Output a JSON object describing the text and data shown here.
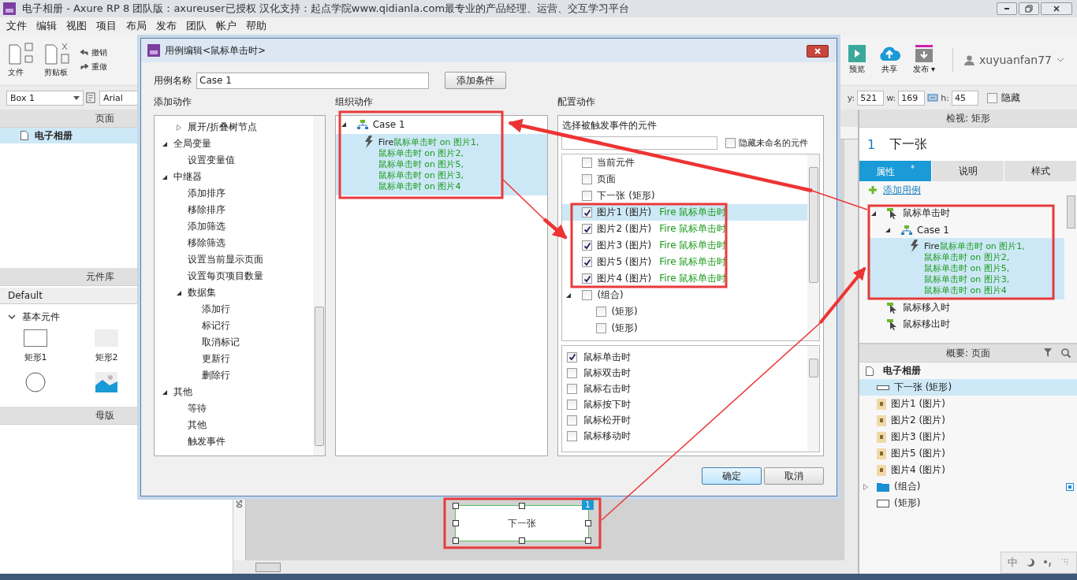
{
  "window": {
    "title": "电子相册 - Axure RP 8 团队版：axureuser已授权 汉化支持：起点学院www.qidianla.com最专业的产品经理、运营、交互学习平台"
  },
  "menu": [
    "文件",
    "编辑",
    "视图",
    "项目",
    "布局",
    "发布",
    "团队",
    "帐户",
    "帮助"
  ],
  "toolbar": {
    "left": [
      {
        "label": "文件",
        "kind": "file"
      },
      {
        "label": "剪贴板",
        "kind": "clipboard"
      }
    ],
    "undo": "撤销",
    "redo": "重做",
    "right": [
      {
        "label": "预览",
        "kind": "preview"
      },
      {
        "label": "共享",
        "kind": "share"
      },
      {
        "label": "发布 ▾",
        "kind": "publish"
      }
    ],
    "user": "xuyuanfan77"
  },
  "format_bar": {
    "widget_name": "Box 1",
    "font": "Arial",
    "fields": [
      {
        "label": "y:",
        "value": "521"
      },
      {
        "label": "w:",
        "value": "169"
      },
      {
        "label": "h:",
        "value": "45"
      }
    ],
    "hidden_label": "隐藏",
    "hidden": false
  },
  "pages_panel": {
    "title": "页面",
    "items": [
      {
        "label": "电子相册",
        "selected": true
      }
    ]
  },
  "library_panel": {
    "title": "元件库",
    "library": "Default",
    "group": "基本元件",
    "expanded": true,
    "widgets": [
      {
        "label": "矩形1",
        "kind": "rect"
      },
      {
        "label": "矩形2",
        "kind": "shaded"
      },
      {
        "kind": "circle"
      },
      {
        "kind": "image"
      }
    ]
  },
  "masters_panel": {
    "title": "母版"
  },
  "canvas": {
    "ruler_mark": "50",
    "widget": {
      "label": "下一张",
      "badge": "1",
      "selected": true
    }
  },
  "inspector": {
    "title": "检视: 矩形",
    "number": "1",
    "name": "下一张",
    "tabs": [
      {
        "label": "属性",
        "badge": "*",
        "selected": true
      },
      {
        "label": "说明",
        "selected": false
      },
      {
        "label": "样式",
        "selected": false
      }
    ],
    "add_case": "添加用例",
    "events": [
      {
        "label": "鼠标单击时",
        "expanded": true,
        "cases": [
          {
            "label": "Case 1",
            "expanded": true,
            "action": {
              "verb": "Fire",
              "lines": [
                "鼠标单击时 on 图片1,",
                "鼠标单击时 on 图片2,",
                "鼠标单击时 on 图片5,",
                "鼠标单击时 on 图片3,",
                "鼠标单击时 on 图片4"
              ],
              "selected": true
            }
          }
        ]
      },
      {
        "label": "鼠标移入时"
      },
      {
        "label": "鼠标移出时"
      }
    ]
  },
  "outline": {
    "title": "概要: 页面",
    "page": "电子相册",
    "items": [
      {
        "label": "下一张 (矩形)",
        "kind": "line",
        "selected": true
      },
      {
        "label": "图片1 (图片)",
        "kind": "image",
        "selected": false
      },
      {
        "label": "图片2 (图片)",
        "kind": "image",
        "selected": false
      },
      {
        "label": "图片3 (图片)",
        "kind": "image",
        "selected": false
      },
      {
        "label": "图片5 (图片)",
        "kind": "image",
        "selected": false
      },
      {
        "label": "图片4 (图片)",
        "kind": "image",
        "selected": false
      },
      {
        "label": "(组合)",
        "kind": "folder",
        "expanded": false,
        "selected": false
      },
      {
        "label": "(矩形)",
        "kind": "rect",
        "selected": false
      }
    ]
  },
  "bottom_tools": {
    "ime": "中"
  },
  "dialog": {
    "title": "用例编辑<鼠标单击时>",
    "case_name_label": "用例名称",
    "case_name": "Case 1",
    "add_condition": "添加条件",
    "add_actions_title": "添加动作",
    "organize_title": "组织动作",
    "configure_title": "配置动作",
    "add_actions": [
      {
        "children": [
          {
            "label": "展开/折叠树节点",
            "expanded": false
          }
        ]
      },
      {
        "label": "全局变量",
        "expanded": true,
        "children": [
          {
            "label": "设置变量值"
          }
        ]
      },
      {
        "label": "中继器",
        "expanded": true,
        "children": [
          {
            "label": "添加排序"
          },
          {
            "label": "移除排序"
          },
          {
            "label": "添加筛选"
          },
          {
            "label": "移除筛选"
          },
          {
            "label": "设置当前显示页面"
          },
          {
            "label": "设置每页项目数量"
          },
          {
            "label": "数据集",
            "expanded": true,
            "children": [
              {
                "label": "添加行"
              },
              {
                "label": "标记行"
              },
              {
                "label": "取消标记"
              },
              {
                "label": "更新行"
              },
              {
                "label": "删除行"
              }
            ]
          }
        ]
      },
      {
        "label": "其他",
        "expanded": true,
        "children": [
          {
            "label": "等待"
          },
          {
            "label": "其他"
          },
          {
            "label": "触发事件"
          }
        ]
      }
    ],
    "case": {
      "label": "Case 1",
      "expanded": true,
      "action": {
        "verb": "Fire",
        "lines": [
          "鼠标单击时 on 图片1,",
          "鼠标单击时 on 图片2,",
          "鼠标单击时 on 图片5,",
          "鼠标单击时 on 图片3,",
          "鼠标单击时 on 图片4"
        ],
        "selected": true
      }
    },
    "config": {
      "title": "选择被触发事件的元件",
      "hide_unnamed": {
        "label": "隐藏未命名的元件",
        "checked": false
      },
      "widgets": [
        {
          "label": "当前元件",
          "checked": false,
          "selected": false
        },
        {
          "label": "页面",
          "checked": false,
          "selected": false
        },
        {
          "label": "下一张 (矩形)",
          "checked": false,
          "selected": false
        },
        {
          "label": "图片1 (图片)",
          "checked": true,
          "selected": true,
          "action": "Fire 鼠标单击时"
        },
        {
          "label": "图片2 (图片)",
          "checked": true,
          "selected": false,
          "action": "Fire 鼠标单击时"
        },
        {
          "label": "图片3 (图片)",
          "checked": true,
          "selected": false,
          "action": "Fire 鼠标单击时"
        },
        {
          "label": "图片5 (图片)",
          "checked": true,
          "selected": false,
          "action": "Fire 鼠标单击时"
        },
        {
          "label": "图片4 (图片)",
          "checked": true,
          "selected": false,
          "action": "Fire 鼠标单击时"
        },
        {
          "label": "(组合)",
          "checked": false,
          "selected": false,
          "expanded": true,
          "children": [
            {
              "label": "(矩形)",
              "checked": false,
              "selected": false
            },
            {
              "label": "(矩形)",
              "checked": false,
              "selected": false
            }
          ]
        }
      ],
      "events": [
        {
          "label": "鼠标单击时",
          "checked": true
        },
        {
          "label": "鼠标双击时",
          "checked": false
        },
        {
          "label": "鼠标右击时",
          "checked": false
        },
        {
          "label": "鼠标按下时",
          "checked": false
        },
        {
          "label": "鼠标松开时",
          "checked": false
        },
        {
          "label": "鼠标移动时",
          "checked": false
        }
      ]
    },
    "ok": "确定",
    "cancel": "取消"
  }
}
